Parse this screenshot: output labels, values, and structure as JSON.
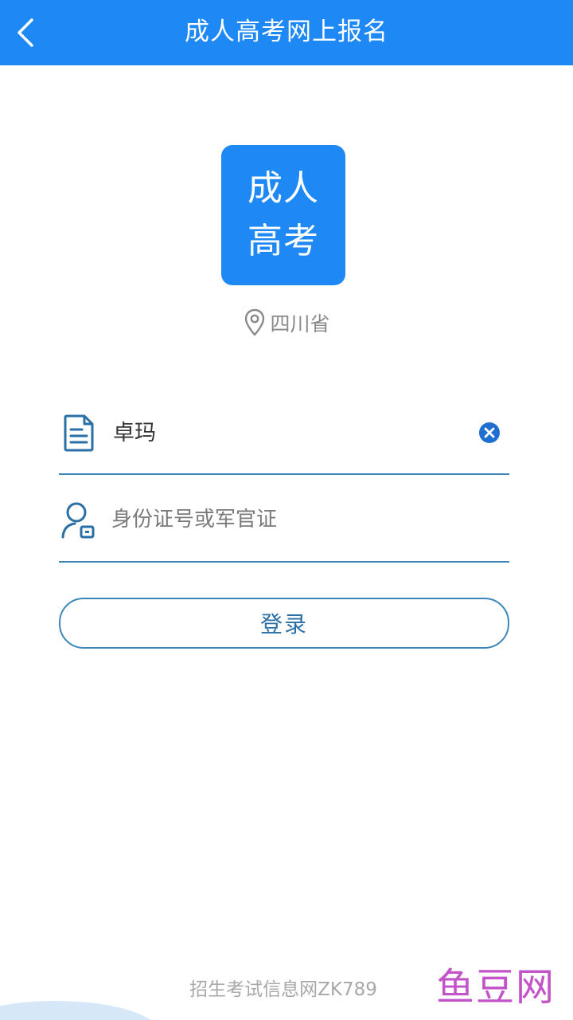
{
  "header": {
    "title": "成人高考网上报名",
    "back_icon": "chevron-left-icon"
  },
  "logo": {
    "line1": "成人",
    "line2": "高考"
  },
  "location": {
    "icon": "location-pin-icon",
    "text": "四川省"
  },
  "form": {
    "name_field": {
      "icon": "document-icon",
      "value": "卓玛",
      "clear_icon": "clear-circle-icon"
    },
    "id_field": {
      "icon": "user-card-icon",
      "placeholder": "身份证号或军官证",
      "value": ""
    },
    "login_button": {
      "label": "登录"
    }
  },
  "footer": {
    "text": "招生考试信息网ZK789"
  },
  "watermark": {
    "text": "鱼豆网"
  },
  "colors": {
    "primary": "#1e88f4",
    "border": "#3b86b8",
    "button_text": "#2a6fa6",
    "muted": "#8a8a8a",
    "watermark": "#c253c8"
  }
}
